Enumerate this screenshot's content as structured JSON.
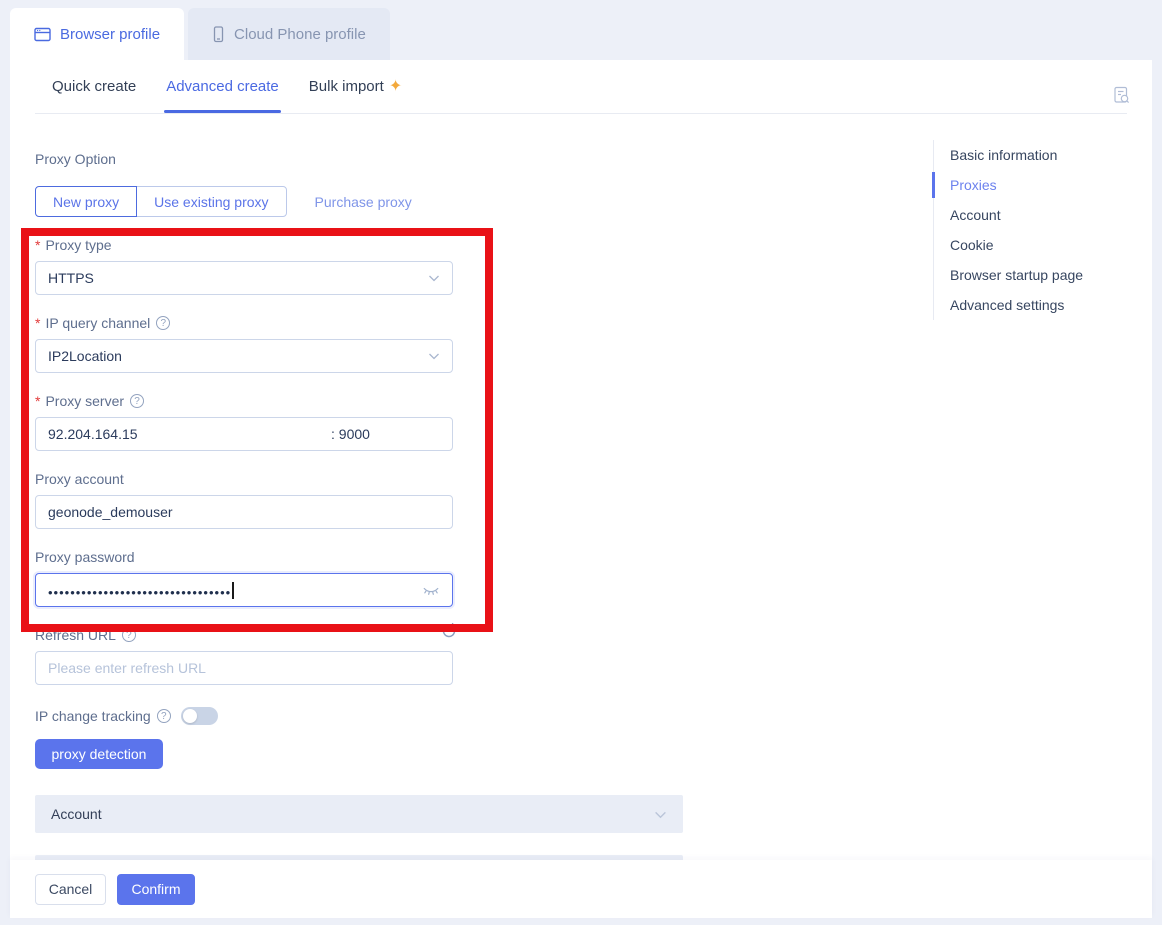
{
  "tabs": {
    "browser_profile": "Browser profile",
    "cloud_phone_profile": "Cloud Phone profile"
  },
  "subtabs": {
    "quick_create": "Quick create",
    "advanced_create": "Advanced create",
    "bulk_import": "Bulk import",
    "bulk_import_badge": "✦"
  },
  "proxy_option": {
    "label": "Proxy Option",
    "new_proxy": "New proxy",
    "use_existing": "Use existing proxy",
    "purchase": "Purchase proxy"
  },
  "required_mark": "*",
  "help_icon": "?",
  "fields": {
    "proxy_type": {
      "label": "Proxy type",
      "value": "HTTPS"
    },
    "ip_query_channel": {
      "label": "IP query channel",
      "value": "IP2Location"
    },
    "proxy_server": {
      "label": "Proxy server",
      "host": "92.204.164.15",
      "port": ": 9000"
    },
    "proxy_account": {
      "label": "Proxy account",
      "value": "geonode_demouser"
    },
    "proxy_password": {
      "label": "Proxy password",
      "masked_value": "•••••••••••••••••••••••••••••••••"
    },
    "refresh_url": {
      "label": "Refresh URL",
      "placeholder": "Please enter refresh URL"
    },
    "ip_change_tracking": {
      "label": "IP change tracking",
      "state": "off"
    }
  },
  "buttons": {
    "proxy_detection": "proxy detection",
    "cancel": "Cancel",
    "confirm": "Confirm"
  },
  "sections": {
    "account": "Account"
  },
  "nav": {
    "items": [
      "Basic information",
      "Proxies",
      "Account",
      "Cookie",
      "Browser startup page",
      "Advanced settings"
    ],
    "active": "Proxies"
  },
  "colors": {
    "accent": "#4a69e2",
    "button_blue": "#5b74ec",
    "highlight_red": "#e91117",
    "sparkle_orange": "#f3a93c"
  }
}
